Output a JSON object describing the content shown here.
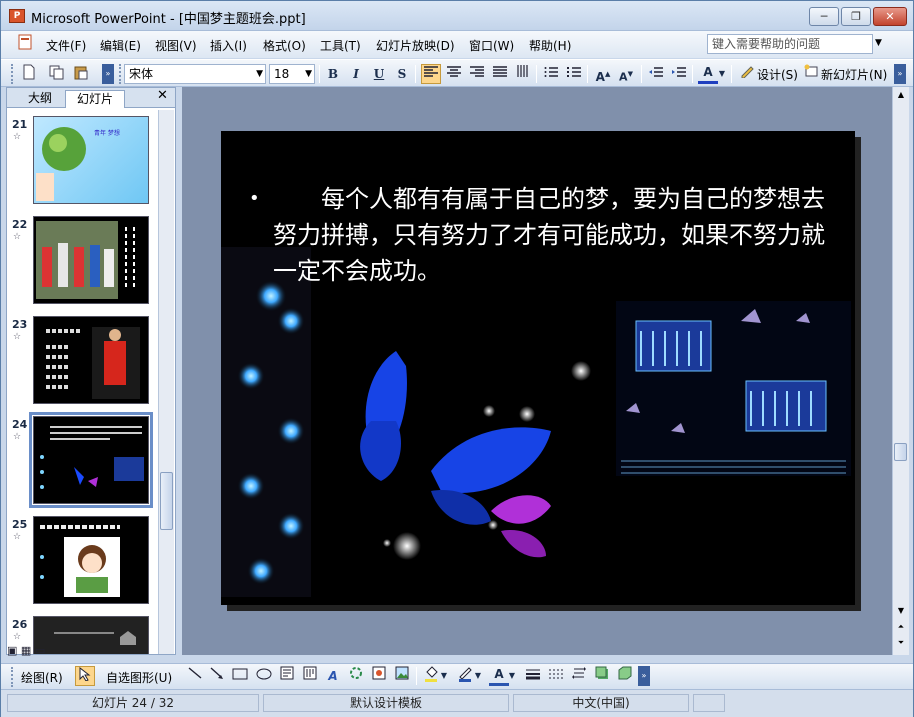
{
  "window": {
    "app_icon": "ppt-icon",
    "title": "Microsoft PowerPoint - [中国梦主题班会.ppt]",
    "minimize": "─",
    "restore": "❐",
    "close": "✕"
  },
  "menu": {
    "items": [
      "文件(F)",
      "编辑(E)",
      "视图(V)",
      "插入(I)",
      "格式(O)",
      "工具(T)",
      "幻灯片放映(D)",
      "窗口(W)",
      "帮助(H)"
    ],
    "help_placeholder": "键入需要帮助的问题"
  },
  "toolbar": {
    "font_name": "宋体",
    "font_size": "18",
    "bold": "B",
    "italic": "I",
    "underline": "U",
    "shadow": "S",
    "design_label": "设计(S)",
    "new_slide_label": "新幻灯片(N)"
  },
  "left_pane": {
    "tab_outline": "大纲",
    "tab_slides": "幻灯片",
    "close": "✕",
    "slides": [
      {
        "num": "21",
        "text": "青年 梦想"
      },
      {
        "num": "22",
        "text": "奋斗"
      },
      {
        "num": "23",
        "text": "我成功了！这梦的过程中，有困难有坎坷有伤感的时候"
      },
      {
        "num": "24",
        "text": "每个人都有有属于自己的梦",
        "selected": true
      },
      {
        "num": "25",
        "text": "另梦要足小，但要做得精致！"
      },
      {
        "num": "26",
        "text": ""
      }
    ]
  },
  "slide": {
    "bullet": "•",
    "text": "每个人都有有属于自己的梦，要为自己的梦想去努力拼搏，只有努力了才有可能成功，如果不努力就一定不会成功。"
  },
  "drawing_toolbar": {
    "draw_label": "绘图(R)",
    "autoshapes_label": "自选图形(U)"
  },
  "status": {
    "slide_counter": "幻灯片 24 / 32",
    "template": "默认设计模板",
    "language": "中文(中国)"
  },
  "colors": {
    "slide_bg": "#000000",
    "butterfly_blue": "#1a4bff",
    "butterfly_purple": "#b030d8",
    "lamp_glow": "#7fd6ff"
  }
}
